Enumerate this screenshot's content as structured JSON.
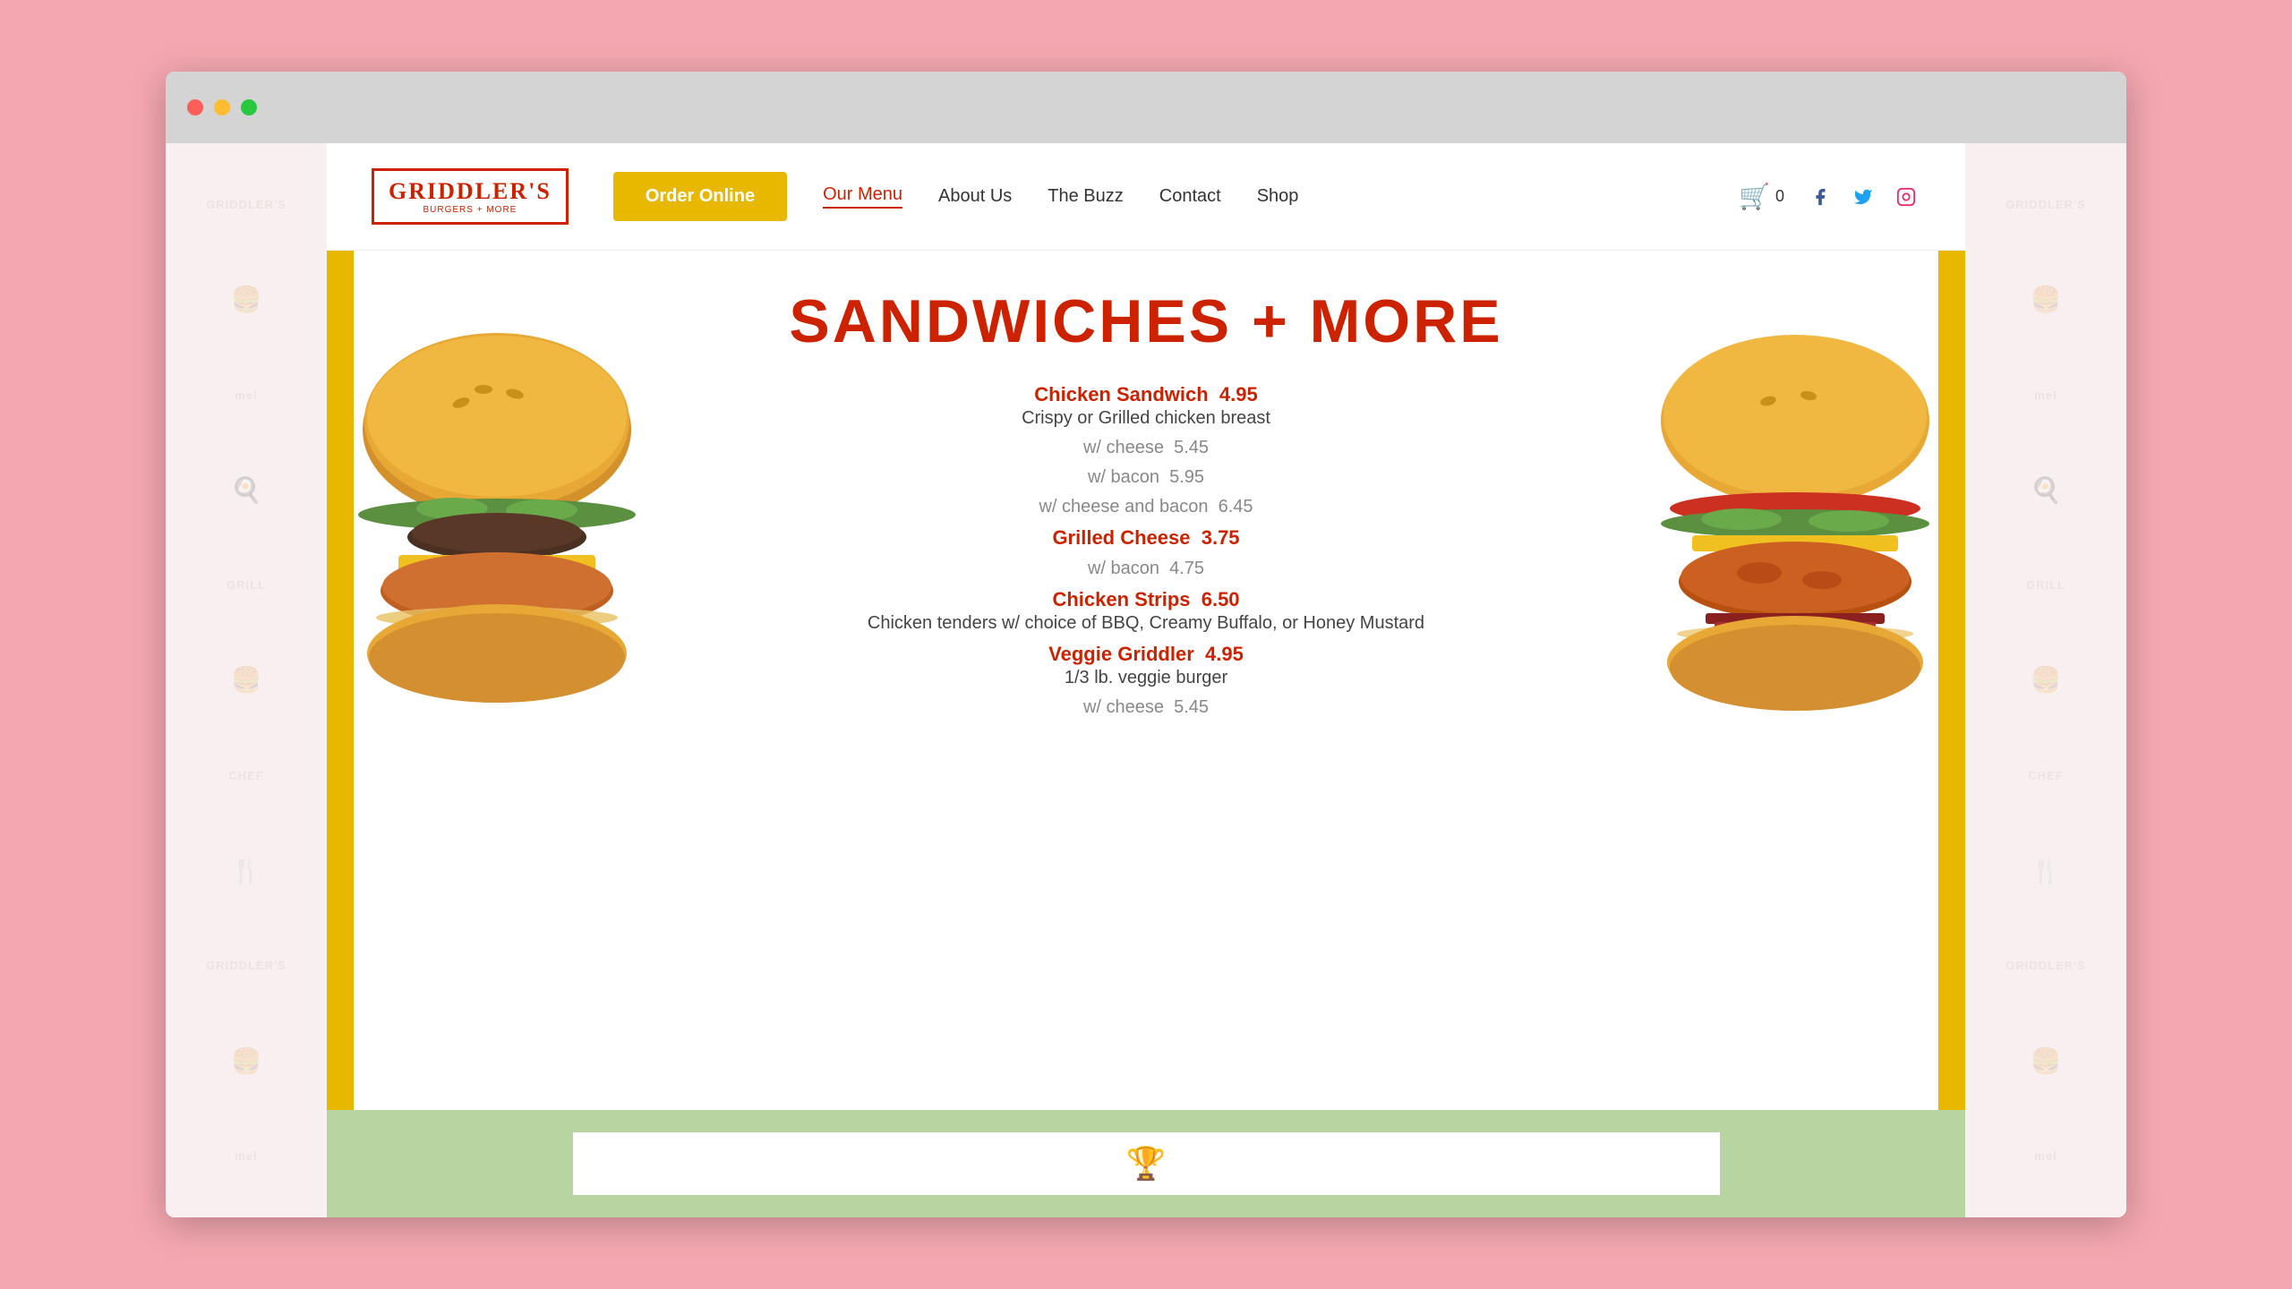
{
  "browser": {
    "dots": [
      "red-dot",
      "yellow-dot",
      "green-dot"
    ]
  },
  "nav": {
    "logo_name": "GRIDDLER'S",
    "logo_subtitle": "BURGERS + MORE",
    "order_btn": "Order Online",
    "links": [
      {
        "label": "Our Menu",
        "active": true
      },
      {
        "label": "About Us",
        "active": false
      },
      {
        "label": "The Buzz",
        "active": false
      },
      {
        "label": "Contact",
        "active": false
      },
      {
        "label": "Shop",
        "active": false
      }
    ],
    "cart_count": "0"
  },
  "social": {
    "facebook": "f",
    "twitter": "t",
    "instagram": "ig"
  },
  "menu": {
    "section_title": "SANDWICHES + MORE",
    "items": [
      {
        "name": "Chicken Sandwich",
        "price": "4.95",
        "description": "Crispy or Grilled chicken breast",
        "options": [
          {
            "label": "w/ cheese",
            "price": "5.45"
          },
          {
            "label": "w/ bacon",
            "price": "5.95"
          },
          {
            "label": "w/ cheese and bacon",
            "price": "6.45"
          }
        ]
      },
      {
        "name": "Grilled Cheese",
        "price": "3.75",
        "description": "",
        "options": [
          {
            "label": "w/ bacon",
            "price": "4.75"
          }
        ]
      },
      {
        "name": "Chicken Strips",
        "price": "6.50",
        "description": "Chicken tenders w/ choice of BBQ, Creamy Buffalo, or Honey Mustard",
        "options": []
      },
      {
        "name": "Veggie Griddler",
        "price": "4.95",
        "description": "1/3 lb. veggie burger",
        "options": [
          {
            "label": "w/ cheese",
            "price": "5.45"
          }
        ]
      }
    ]
  },
  "colors": {
    "red": "#cc2200",
    "yellow": "#e8b800",
    "green": "#b8d4a0",
    "pink_bg": "#f4a7b0"
  }
}
